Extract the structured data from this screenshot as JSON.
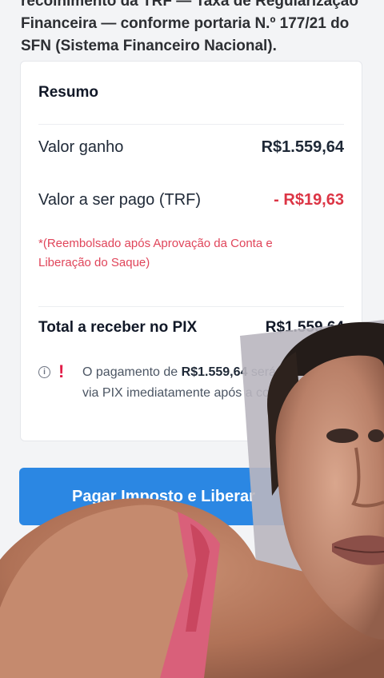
{
  "intro": {
    "line1": "recolhimento da TRF — Taxa de Regularização",
    "line2": "Financeira — conforme portaria N.º 177/21 do",
    "line3": "SFN (Sistema Financeiro Nacional)."
  },
  "summary": {
    "title": "Resumo",
    "earned_label": "Valor ganho",
    "earned_value": "R$1.559,64",
    "fee_label": "Valor a ser pago (TRF)",
    "fee_value": "- R$19,63",
    "note": "*(Reembolsado após Aprovação da Conta e Liberação do Saque)",
    "total_label": "Total a receber no PIX",
    "total_value": "R$1.559,64"
  },
  "info": {
    "icon": "info-icon",
    "alert_icon": "exclamation-icon",
    "text_before": "O pagamento de ",
    "amount": "R$1.559,64",
    "text_after": " será processado via PIX imediatamente após a confirmação."
  },
  "button": {
    "label": "Pagar Imposto e Liberar"
  },
  "colors": {
    "accent": "#2b87e3",
    "alert": "#dc3545"
  }
}
